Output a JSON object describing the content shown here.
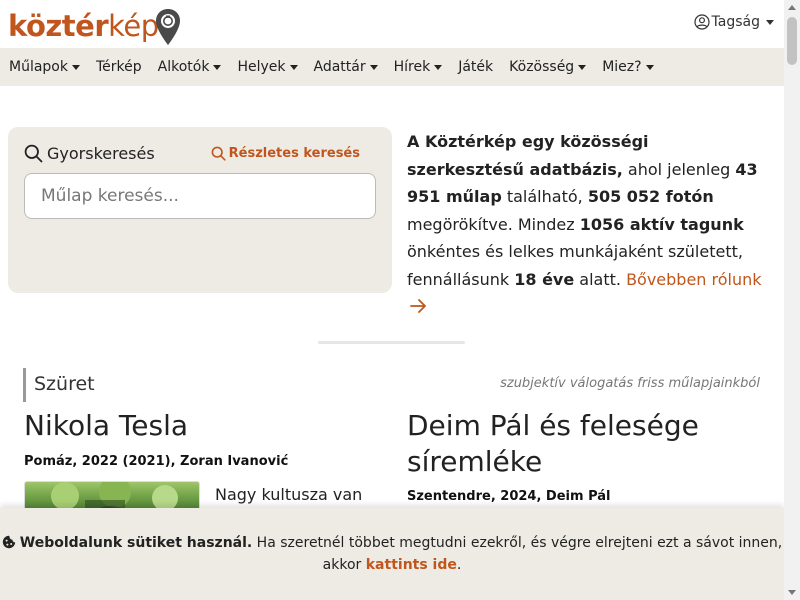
{
  "header": {
    "logo_part1": "köztér",
    "logo_part2": "kép",
    "account_label": "Tagság"
  },
  "nav": {
    "items": [
      {
        "label": "Műlapok",
        "dropdown": true
      },
      {
        "label": "Térkép",
        "dropdown": false
      },
      {
        "label": "Alkotók",
        "dropdown": true
      },
      {
        "label": "Helyek",
        "dropdown": true
      },
      {
        "label": "Adattár",
        "dropdown": true
      },
      {
        "label": "Hírek",
        "dropdown": true
      },
      {
        "label": "Játék",
        "dropdown": false
      },
      {
        "label": "Közösség",
        "dropdown": true
      },
      {
        "label": "Miez?",
        "dropdown": true
      }
    ]
  },
  "search": {
    "title": "Gyorskeresés",
    "advanced_label": "Részletes keresés",
    "placeholder": "Műlap keresés..."
  },
  "intro": {
    "t1": "A Köztérkép egy közösségi szerkesztésű adatbázis,",
    "t2": " ahol jelenleg ",
    "works": "43 951 műlap",
    "t3": " található, ",
    "photos": "505 052 fotón",
    "t4": " megörökítve. Mindez ",
    "members": "1056 aktív tagunk",
    "t5": " önkéntes és lelkes munkájaként született, fennállásunk ",
    "years": "18 éve",
    "t6": " alatt. ",
    "more": "Bővebben rólunk"
  },
  "featured": {
    "section_title": "Szüret",
    "section_note": "szubjektív válogatás friss műlapjainkból",
    "cards": [
      {
        "title": "Nikola Tesla",
        "meta": "Pomáz, 2022 (2021), Zoran Ivanović",
        "excerpt": "Nagy kultusza van"
      },
      {
        "title": "Deim Pál és felesége síremléke",
        "meta": "Szentendre, 2024, Deim Pál"
      }
    ]
  },
  "cookie": {
    "bold": "Weboldalunk sütiket használ.",
    "text": " Ha szeretnél többet megtudni ezekről, és végre elrejteni ezt a sávot innen, akkor ",
    "link": "kattints ide",
    "end": "."
  },
  "colors": {
    "brand": "#c0561d",
    "panel": "#eeebe5"
  }
}
